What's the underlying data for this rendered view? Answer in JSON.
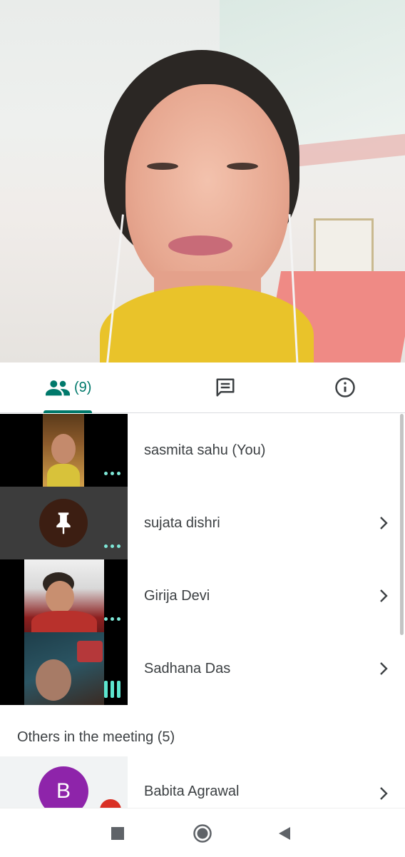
{
  "tabs": {
    "people_count": "(9)",
    "chat_icon": "chat-icon",
    "info_icon": "info-icon"
  },
  "participants": [
    {
      "name": "sasmita sahu (You)",
      "indicator": "more-dots",
      "has_chevron": false
    },
    {
      "name": "sujata dishri",
      "indicator": "more-dots",
      "has_chevron": true
    },
    {
      "name": "Girija Devi",
      "indicator": "more-dots",
      "has_chevron": true
    },
    {
      "name": "Sadhana Das",
      "indicator": "speaking-bars",
      "has_chevron": true
    }
  ],
  "others": {
    "header": "Others in the meeting (5)",
    "items": [
      {
        "initial": "B",
        "name": "Babita Agrawal",
        "avatar_color": "#8e24aa"
      }
    ]
  },
  "colors": {
    "accent": "#00796b",
    "indicator": "#5ce6cf",
    "mute": "#d93025"
  },
  "navbar": {
    "recents": "recents-icon",
    "home": "home-icon",
    "back": "back-icon"
  }
}
